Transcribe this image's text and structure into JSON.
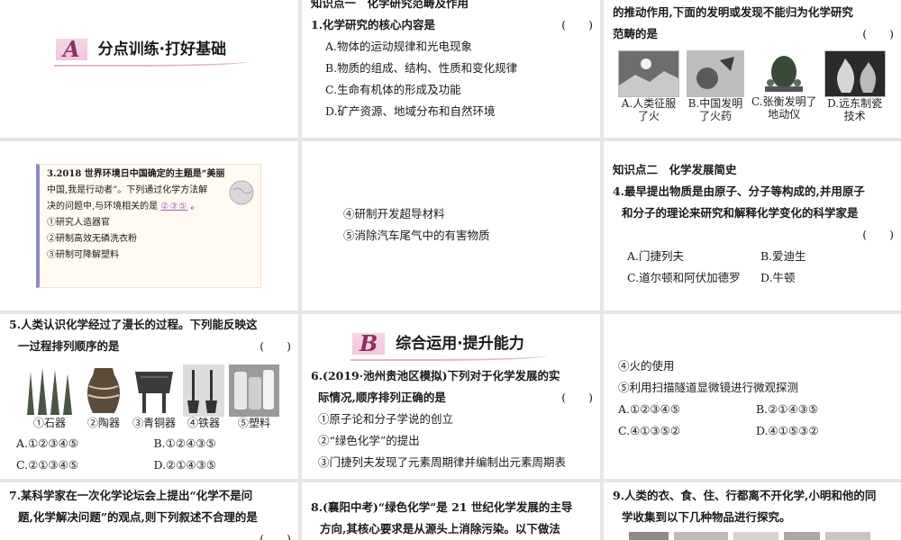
{
  "sectionA": {
    "letter": "A",
    "title": "分点训练·打好基础"
  },
  "sectionB": {
    "letter": "B",
    "title": "综合运用·提升能力"
  },
  "q1": {
    "header": "知识点一　化学研究范畴及作用",
    "stem": "1.化学研究的核心内容是",
    "paren": "(　　)",
    "options": [
      "A.物体的运动规律和光电现象",
      "B.物质的组成、结构、性质和变化规律",
      "C.生命有机体的形成及功能",
      "D.矿产资源、地域分布和自然环境"
    ]
  },
  "q2": {
    "line1": "的推动作用,下面的发明或发现不能归为化学研究",
    "line2": "范畴的是",
    "paren": "(　　)",
    "captions": [
      [
        "A.人类征服",
        "了火"
      ],
      [
        "B.中国发明",
        "了火药"
      ],
      [
        "C.张衡发明了",
        "地动仪"
      ],
      [
        "D.远东制瓷",
        "技术"
      ]
    ]
  },
  "q3": {
    "line1": "3.2018 世界环境日中国确定的主题是“美丽",
    "line2": "中国,我是行动者”。下列通过化学方法解",
    "line3": "决的问题中,与环境相关的是",
    "answer": "②③⑤",
    "tail": "。",
    "items": [
      "①研究人造器官",
      "②研制高效无磷洗衣粉",
      "③研制可降解塑料"
    ]
  },
  "q3cont": {
    "items": [
      "④研制开发超导材料",
      "⑤消除汽车尾气中的有害物质"
    ]
  },
  "q4": {
    "header": "知识点二　化学发展简史",
    "line1": "4.最早提出物质是由原子、分子等构成的,并用原子",
    "line2": "和分子的理论来研究和解释化学变化的科学家是",
    "paren": "(　　)",
    "options": [
      "A.门捷列夫",
      "B.爱迪生",
      "C.道尔顿和阿伏加德罗",
      "D.牛顿"
    ]
  },
  "q5": {
    "line1": "5.人类认识化学经过了漫长的过程。下列能反映这",
    "line2": "一过程排列顺序的是",
    "paren": "(　　)",
    "captions": [
      "①石器",
      "②陶器",
      "③青铜器",
      "④铁器",
      "⑤塑料"
    ],
    "options": [
      "A.①②③④⑤",
      "B.①②④③⑤",
      "C.②①③④⑤",
      "D.②①④③⑤"
    ]
  },
  "q6": {
    "line1": "6.(2019·池州贵池区模拟)下列对于化学发展的实",
    "line2": "际情况,顺序排列正确的是",
    "paren": "(　　)",
    "items": [
      "①原子论和分子学说的创立",
      "②“绿色化学”的提出",
      "③门捷列夫发现了元素周期律并编制出元素周期表"
    ]
  },
  "q6cont": {
    "items": [
      "④火的使用",
      "⑤利用扫描隧道显微镜进行微观探测"
    ],
    "options": [
      "A.①②③④⑤",
      "B.②①④③⑤",
      "C.④①③⑤②",
      "D.④①⑤③②"
    ]
  },
  "q7": {
    "line1": "7.某科学家在一次化学论坛会上提出“化学不是问",
    "line2": "题,化学解决问题”的观点,则下列叙述不合理的是",
    "paren": "(　　)"
  },
  "q8": {
    "line1": "8.(襄阳中考)“绿色化学”是 21 世纪化学发展的主导",
    "line2": "方向,其核心要求是从源头上消除污染。以下做法"
  },
  "q9": {
    "line1": "9.人类的衣、食、住、行都离不开化学,小明和他的同",
    "line2": "学收集到以下几种物品进行探究。"
  },
  "colors": {
    "accent": "#8a2f62",
    "answer": "#9b63b8"
  }
}
